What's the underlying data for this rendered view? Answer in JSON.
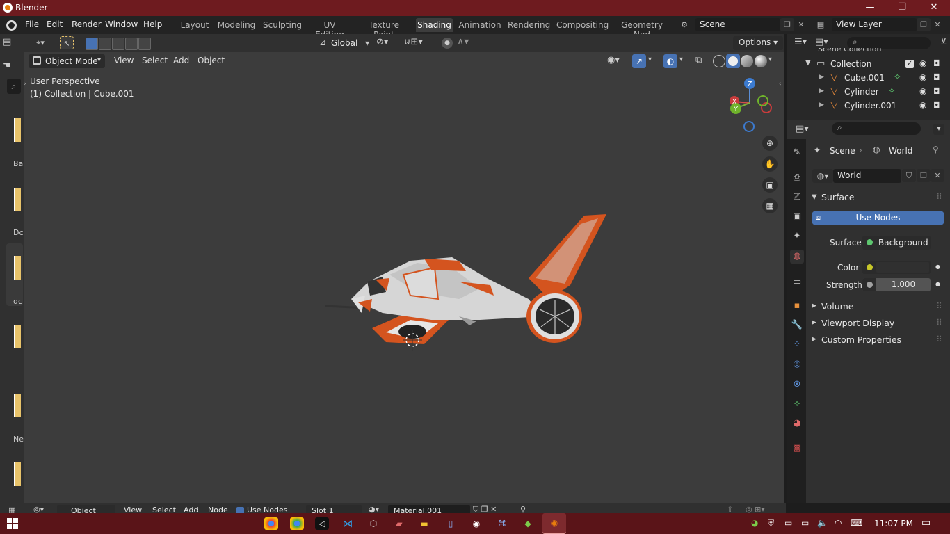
{
  "window": {
    "title": "Blender",
    "min": "—",
    "max": "❐",
    "close": "✕"
  },
  "menu": {
    "items": [
      "File",
      "Edit",
      "Render",
      "Window",
      "Help"
    ]
  },
  "workspaces": {
    "tabs": [
      "Layout",
      "Modeling",
      "Sculpting",
      "UV Editing",
      "Texture Paint",
      "Shading",
      "Animation",
      "Rendering",
      "Compositing",
      "Geometry Nod"
    ],
    "active": "Shading"
  },
  "scene": {
    "name": "Scene"
  },
  "viewlayer": {
    "name": "View Layer"
  },
  "toolbar": {
    "transform_orientation": "Global",
    "options_label": "Options"
  },
  "viewport": {
    "mode": "Object Mode",
    "menus": [
      "View",
      "Select",
      "Add",
      "Object"
    ],
    "perspective": "User Perspective",
    "collection_info": "(1) Collection | Cube.001",
    "gizmo_axes": {
      "x": "X",
      "y": "Y",
      "z": "Z"
    }
  },
  "outliner": {
    "header_partial": "Scene Collection",
    "collection": "Collection",
    "items": [
      "Cube.001",
      "Cylinder",
      "Cylinder.001"
    ]
  },
  "properties": {
    "breadcrumb_scene": "Scene",
    "breadcrumb_world": "World",
    "world_name": "World",
    "panel_surface": "Surface",
    "use_nodes": "Use Nodes",
    "surface_label": "Surface",
    "surface_value": "Background",
    "color_label": "Color",
    "strength_label": "Strength",
    "strength_value": "1.000",
    "panels": [
      "Volume",
      "Viewport Display",
      "Custom Properties"
    ]
  },
  "left_browser": {
    "labels": [
      "Ba",
      "Dc",
      "dc",
      "Ne"
    ]
  },
  "bottom_header": {
    "mode": "Object",
    "menus": [
      "View",
      "Select",
      "Add",
      "Node"
    ],
    "use_nodes": "Use Nodes",
    "slot": "Slot 1",
    "material": "Material.001"
  },
  "taskbar": {
    "time": "11:07 PM"
  },
  "colors": {
    "accent": "#4772b3",
    "titlebar": "#6e1b1f",
    "taskbar": "#5a1418",
    "model_orange": "#d4541f",
    "model_white": "#cfcfcf"
  }
}
